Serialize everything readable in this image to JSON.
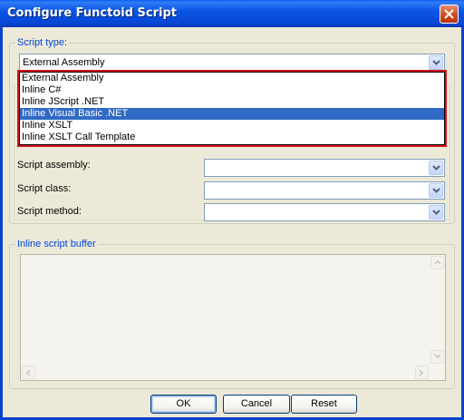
{
  "window": {
    "title": "Configure Functoid Script"
  },
  "script_type": {
    "group_label": "Script type:",
    "selected_value": "External Assembly",
    "options": [
      "External Assembly",
      "Inline C#",
      "Inline JScript .NET",
      "Inline Visual Basic .NET",
      "Inline XSLT",
      "Inline XSLT Call Template"
    ],
    "highlighted_option": "Inline Visual Basic .NET"
  },
  "fields": {
    "assembly_label": "Script assembly:",
    "class_label": "Script class:",
    "method_label": "Script method:",
    "assembly_value": "",
    "class_value": "",
    "method_value": ""
  },
  "inline_buffer": {
    "group_label": "Inline script buffer",
    "content": ""
  },
  "buttons": {
    "ok": "OK",
    "cancel": "Cancel",
    "reset": "Reset"
  },
  "colors": {
    "title_bar": "#0a55e5",
    "selection": "#316ac5",
    "highlight_frame": "#d9111b",
    "dialog_bg": "#ece9d8"
  }
}
